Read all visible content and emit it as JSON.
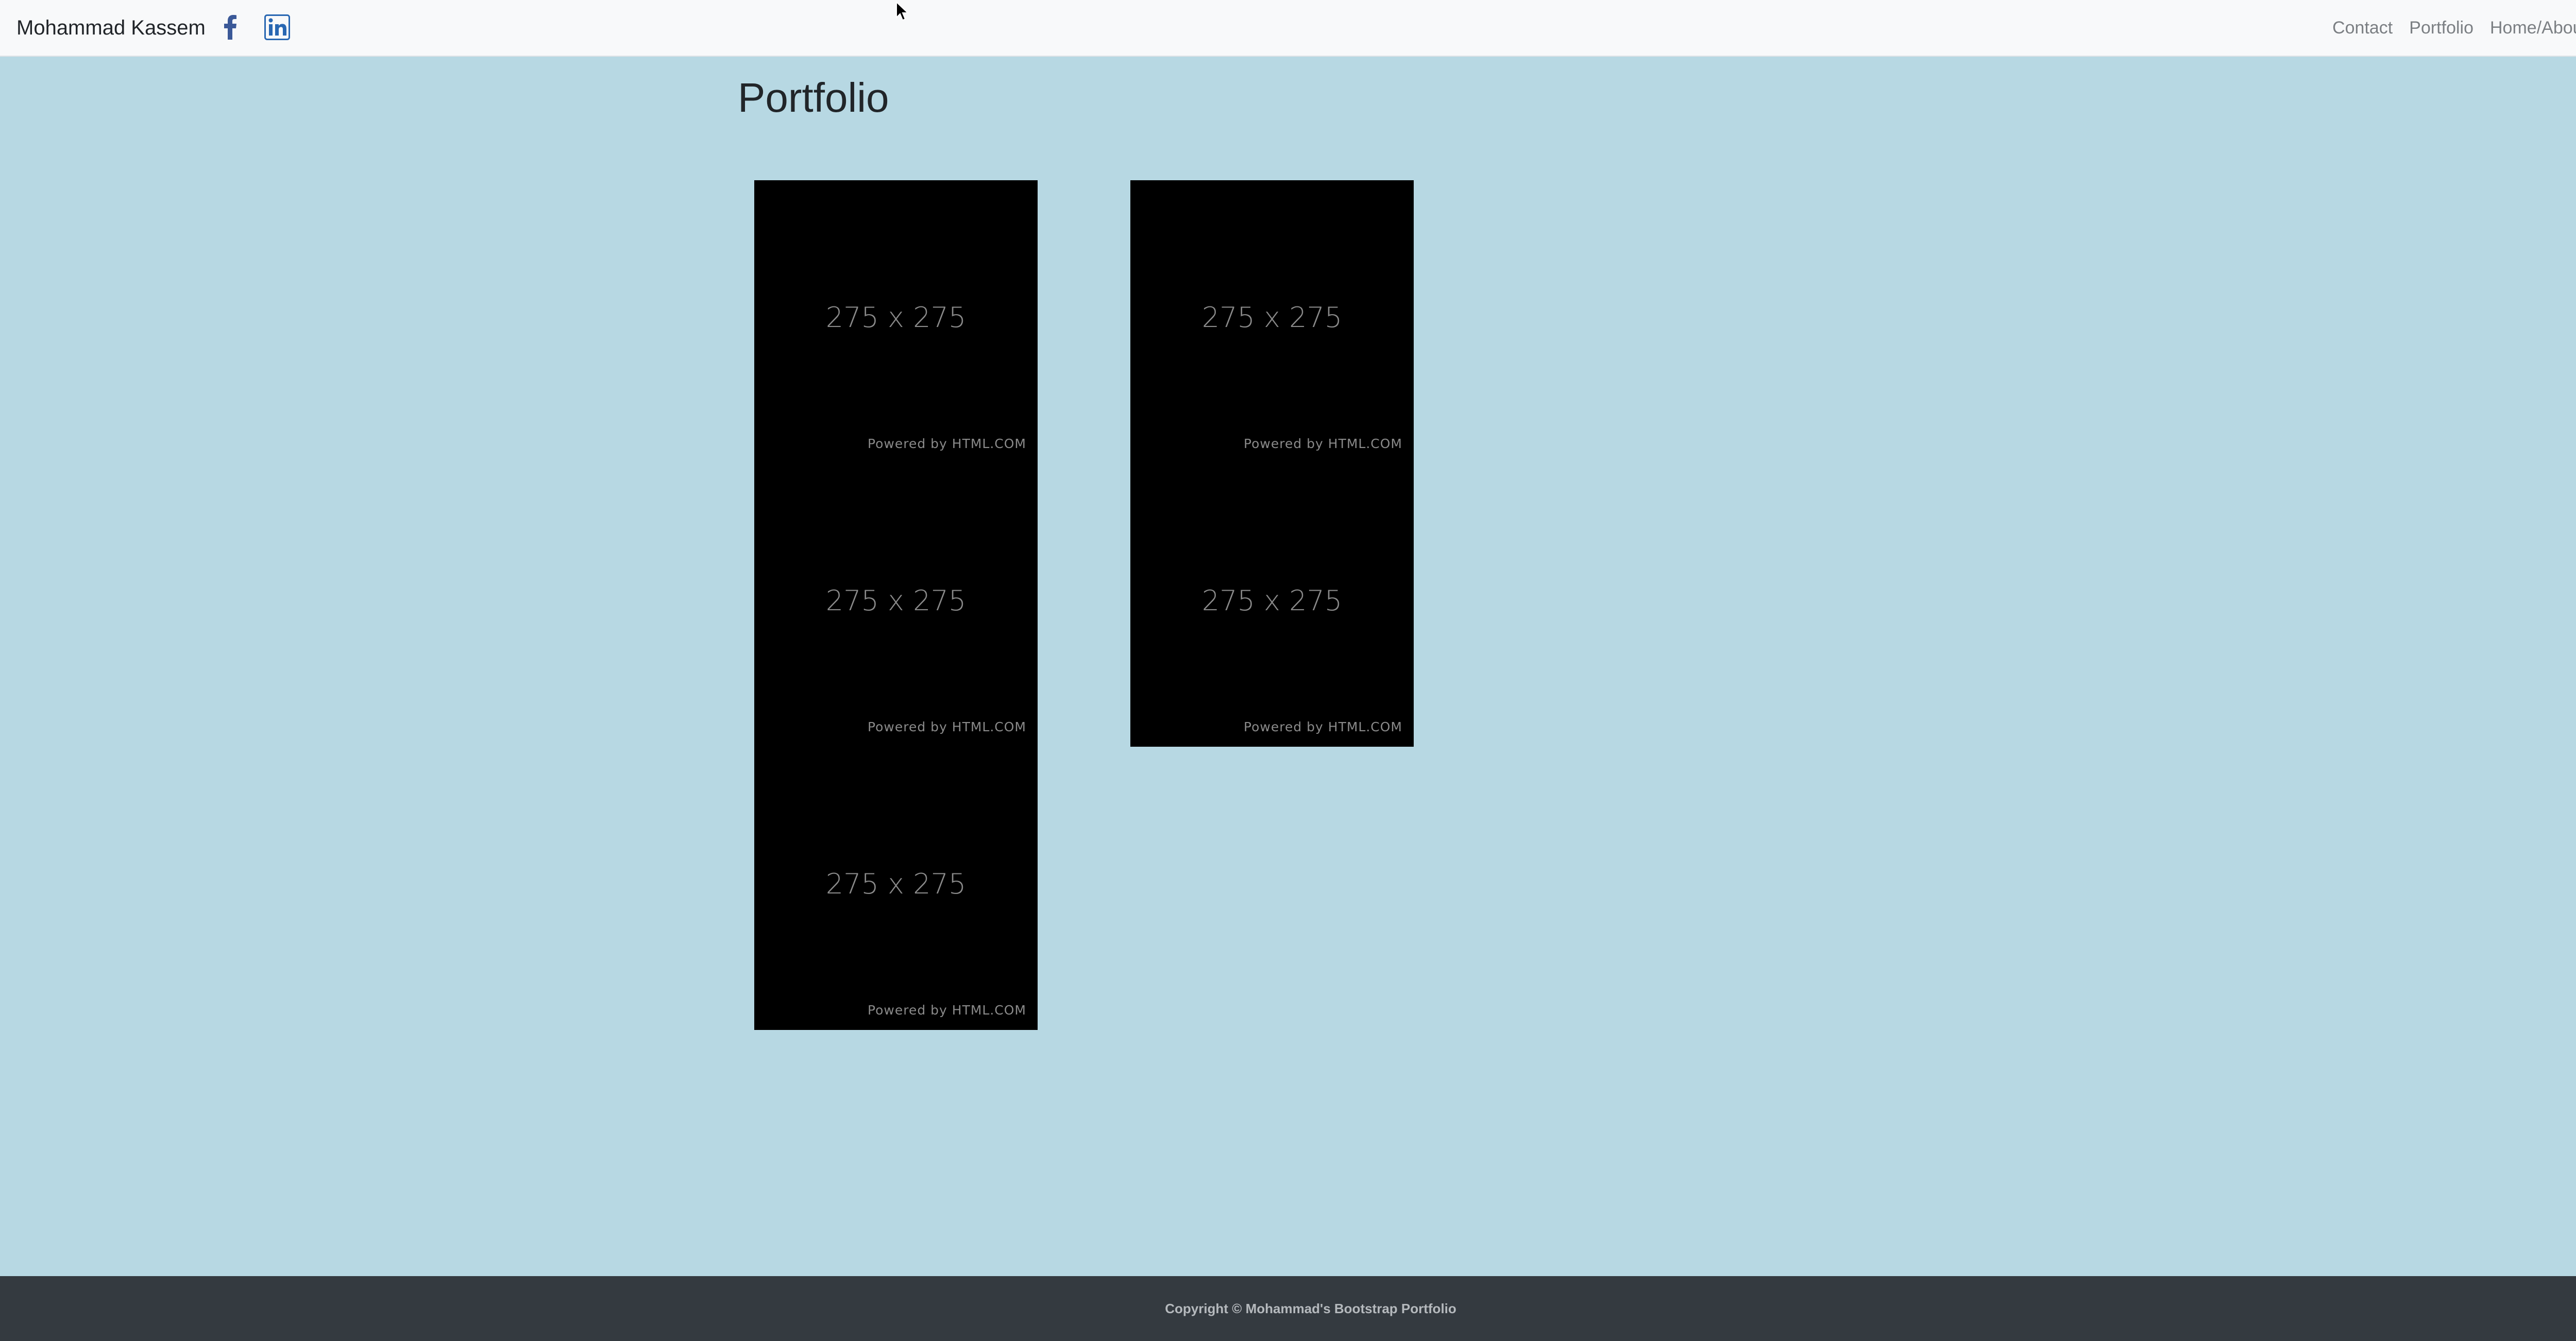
{
  "navbar": {
    "brand": "Mohammad Kassem",
    "social": [
      {
        "icon": "facebook-icon",
        "color": "#3b5998"
      },
      {
        "icon": "linkedin-icon",
        "color": "#2867b2"
      }
    ],
    "links": [
      "Contact",
      "Portfolio",
      "Home/About"
    ]
  },
  "main": {
    "title": "Portfolio",
    "columns": [
      {
        "tiles": [
          {
            "size": "275 x 275",
            "powered": "Powered by HTML.COM"
          },
          {
            "size": "275 x 275",
            "powered": "Powered by HTML.COM"
          },
          {
            "size": "275 x 275",
            "powered": "Powered by HTML.COM"
          }
        ]
      },
      {
        "tiles": [
          {
            "size": "275 x 275",
            "powered": "Powered by HTML.COM"
          },
          {
            "size": "275 x 275",
            "powered": "Powered by HTML.COM"
          }
        ]
      }
    ]
  },
  "footer": {
    "copyright": "Copyright © Mohammad's Bootstrap Portfolio"
  },
  "colors": {
    "background": "#b7d8e3",
    "navbar": "#f8f9fa",
    "footer": "#343a40",
    "tile": "#000000"
  }
}
